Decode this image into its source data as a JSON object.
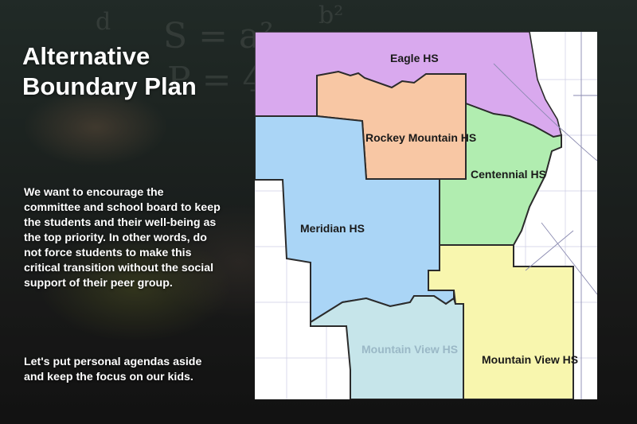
{
  "slide": {
    "title_line1": "Alternative",
    "title_line2": "Boundary Plan",
    "paragraph1": "We want to encourage the committee and school board to keep the students and their well-being as the top priority.  In other words, do not force students to make this critical transition without the social support of their peer group.",
    "paragraph2": "Let's put personal agendas aside and keep the focus on our kids."
  },
  "map": {
    "zones": [
      {
        "id": "eagle",
        "label": "Eagle HS",
        "color": "#d9a9ee"
      },
      {
        "id": "rockey-mountain",
        "label": "Rockey Mountain HS",
        "color": "#f8c7a4"
      },
      {
        "id": "centennial",
        "label": "Centennial HS",
        "color": "#b1edb0"
      },
      {
        "id": "meridian",
        "label": "Meridian HS",
        "color": "#aad5f6"
      },
      {
        "id": "mountain-view-west",
        "label": "Mountain View HS",
        "color": "#c6e5ea"
      },
      {
        "id": "mountain-view-east",
        "label": "Mountain View HS",
        "color": "#f8f6ae"
      }
    ]
  },
  "colors": {
    "background": "#2a2b2a",
    "title_text": "#ffffff",
    "boundary_line": "#2b2b2b"
  }
}
